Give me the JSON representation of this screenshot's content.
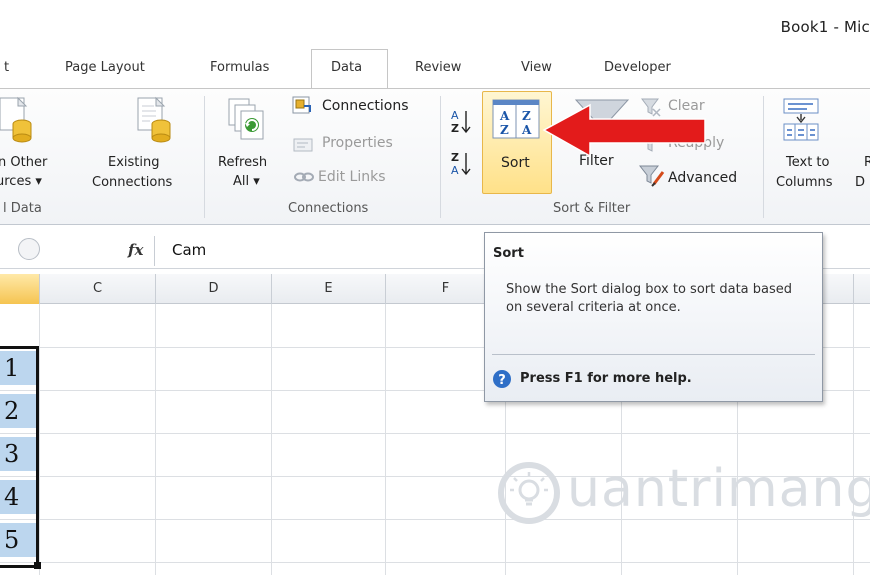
{
  "window": {
    "title": "Book1 - Mic"
  },
  "tabs": [
    {
      "label": "t"
    },
    {
      "label": "Page Layout"
    },
    {
      "label": "Formulas"
    },
    {
      "label": "Data"
    },
    {
      "label": "Review"
    },
    {
      "label": "View"
    },
    {
      "label": "Developer"
    }
  ],
  "ribbon": {
    "get_external": {
      "from_other_line1": "n Other",
      "from_other_line2": "urces ▾",
      "existing_line1": "Existing",
      "existing_line2": "Connections",
      "group_label": "l Data"
    },
    "connections": {
      "refresh_line1": "Refresh",
      "refresh_line2": "All ▾",
      "connections": "Connections",
      "properties": "Properties",
      "edit_links": "Edit Links",
      "group_label": "Connections"
    },
    "sort_filter": {
      "sort_label": "Sort",
      "filter_label": "Filter",
      "clear_label": "Clear",
      "reapply_label": "Reapply",
      "advanced_label": "Advanced",
      "group_label": "Sort & Filter"
    },
    "data_tools": {
      "text_to_line1": "Text to",
      "text_to_line2": "Columns",
      "next_line1": "R",
      "next_line2": "D"
    }
  },
  "formula_bar": {
    "fx": "fx",
    "value": "Cam"
  },
  "columns": [
    "C",
    "D",
    "E",
    "F"
  ],
  "cells": [
    "1",
    "2",
    "3",
    "4",
    "5"
  ],
  "tooltip": {
    "title": "Sort",
    "body": "Show the Sort dialog box to sort data based on several criteria at once.",
    "help": "Press F1 for more help."
  },
  "watermark": {
    "text": "uantrimang"
  },
  "colors": {
    "arrow": "#e31b1b",
    "selection_fill": "#bcd6ee",
    "active_highlight": "#ffe189"
  }
}
